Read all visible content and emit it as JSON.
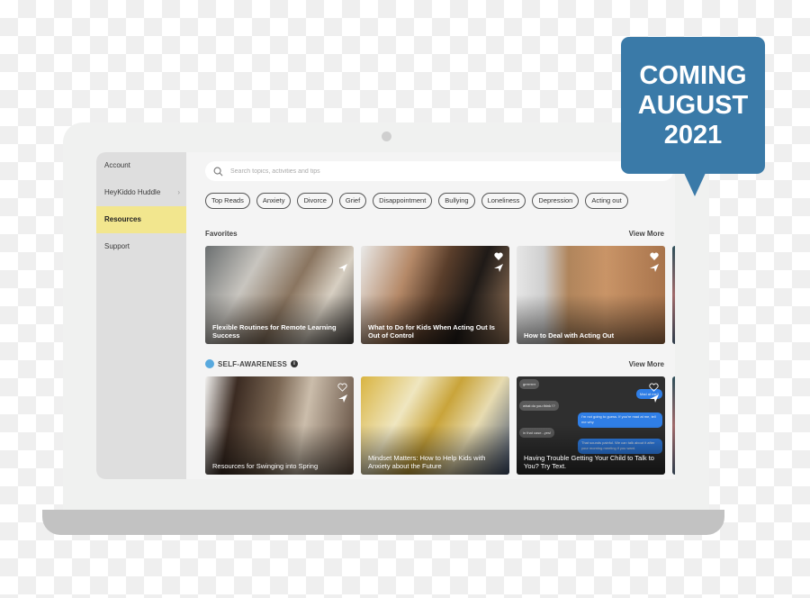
{
  "sidebar": {
    "items": [
      {
        "label": "Account",
        "active": false
      },
      {
        "label": "HeyKiddo Huddle",
        "active": false,
        "has_chevron": true
      },
      {
        "label": "Resources",
        "active": true
      },
      {
        "label": "Support",
        "active": false
      }
    ],
    "chevron_glyph": "›"
  },
  "search": {
    "placeholder": "Search topics, activities and tips",
    "value": ""
  },
  "chips": [
    "Top Reads",
    "Anxiety",
    "Divorce",
    "Grief",
    "Disappointment",
    "Bullying",
    "Loneliness",
    "Depression",
    "Acting out"
  ],
  "favorites": {
    "title": "Favorites",
    "view_more": "View More",
    "cards": [
      {
        "title": "Flexible Routines for Remote Learning Success",
        "heart": "outline"
      },
      {
        "title": "What to Do for Kids When Acting Out Is Out of Control",
        "heart": "filled"
      },
      {
        "title": "How to Deal with Acting Out",
        "heart": "filled"
      }
    ]
  },
  "self_awareness": {
    "title": "SELF-AWARENESS",
    "info_glyph": "i",
    "view_more": "View More",
    "cards": [
      {
        "title": "Resources for Swinging into Spring",
        "heart": "outline"
      },
      {
        "title": "Mindset Matters: How to Help Kids with Anxiety about the Future",
        "heart": "outline"
      },
      {
        "title": "Having Trouble Getting Your Child to Talk to You? Try Text.",
        "heart": "outline"
      }
    ],
    "chat_bubbles": [
      {
        "text": "grrrrrrrrr",
        "side": "left"
      },
      {
        "text": "Mad at me?",
        "side": "right"
      },
      {
        "text": "what do you think !?",
        "side": "left"
      },
      {
        "text": "I'm not going to guess. If you're mad at me, tell me why",
        "side": "right"
      },
      {
        "text": "in that case...yes!",
        "side": "left"
      },
      {
        "text": "That sounds painful. We can talk about it after your morning meeting if you want.",
        "side": "right"
      }
    ]
  },
  "callout": {
    "lines": [
      "COMING",
      "AUGUST",
      "2021"
    ],
    "color": "#3a7aa8"
  },
  "colors": {
    "active_nav": "#f2e68e",
    "sidebar_bg": "#dedede",
    "accent_blue": "#58a9de"
  }
}
